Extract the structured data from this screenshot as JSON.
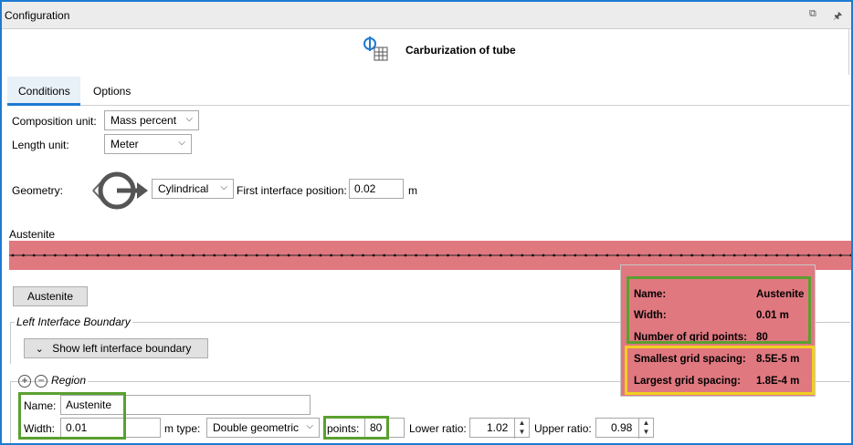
{
  "window": {
    "title": "Configuration",
    "restore_icon": "restore-icon",
    "pin_icon": "pin-icon",
    "accent_color": "#1e7ad1"
  },
  "header": {
    "title": "Carburization of tube",
    "icon": "diffusion-calculator-icon"
  },
  "tabs": [
    {
      "label": "Conditions",
      "active": true
    },
    {
      "label": "Options",
      "active": false
    }
  ],
  "form": {
    "composition_unit_label": "Composition unit:",
    "composition_unit_value": "Mass percent",
    "length_unit_label": "Length unit:",
    "length_unit_value": "Meter",
    "geometry_label": "Geometry:",
    "geometry_value": "Cylindrical",
    "first_interface_label": "First interface position:",
    "first_interface_value": "0.02",
    "first_interface_unit": "m"
  },
  "region_bar": {
    "label": "Austenite",
    "color": "#e07880",
    "button_label": "Austenite"
  },
  "left_boundary": {
    "title": "Left Interface Boundary",
    "button_label": "Show left interface boundary",
    "button_icon": "chevron-down-icon"
  },
  "region": {
    "title": "Region",
    "add_icon": "add-circle-icon",
    "remove_icon": "remove-circle-icon",
    "name_label": "Name:",
    "name_value": "Austenite",
    "width_label": "Width:",
    "width_value": "0.01",
    "width_unit_type_label": "m type:",
    "grid_type_value": "Double geometric",
    "points_label": "points:",
    "points_value": "80",
    "lower_ratio_label": "Lower ratio:",
    "lower_ratio_value": "1.02",
    "upper_ratio_label": "Upper ratio:",
    "upper_ratio_value": "0.98"
  },
  "tooltip": {
    "rows": [
      {
        "label": "Name:",
        "value": "Austenite"
      },
      {
        "label": "Width:",
        "value": "0.01 m"
      },
      {
        "label": "Number of grid points:",
        "value": "80"
      },
      {
        "label": "Smallest grid spacing:",
        "value": "8.5E-5 m"
      },
      {
        "label": "Largest grid spacing:",
        "value": "1.8E-4 m"
      }
    ]
  },
  "highlight_colors": {
    "green": "#5aa030",
    "yellow": "#f0d020"
  }
}
